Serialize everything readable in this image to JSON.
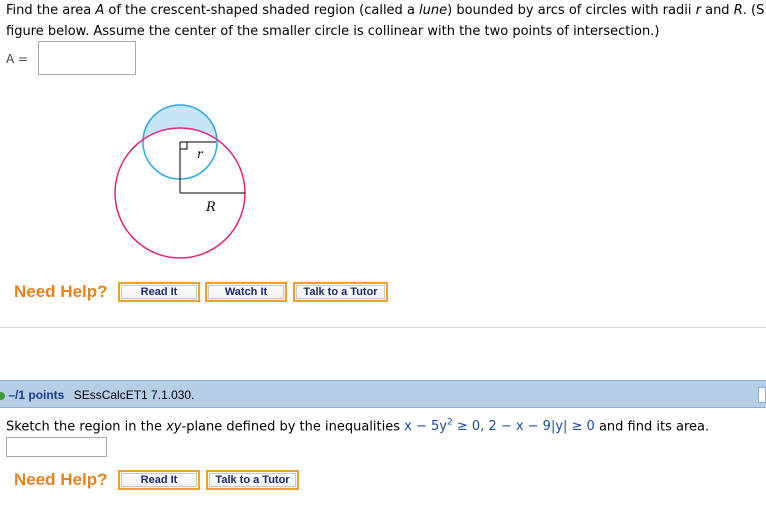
{
  "question1": {
    "line1_a": "Find the area ",
    "line1_var_A": "A",
    "line1_b": " of the crescent-shaped shaded region (called a ",
    "line1_lune": "lune",
    "line1_c": ") bounded by arcs of circles with radii ",
    "line1_var_r": "r",
    "line1_d": " and ",
    "line1_var_R": "R",
    "line1_e": ". (S",
    "line2": "figure below. Assume the center of the smaller circle is collinear with the two points of intersection.)",
    "answer_label": "A =",
    "answer_value": "",
    "figure": {
      "small_radius_label": "r",
      "large_radius_label": "R"
    },
    "need_help": "Need Help?",
    "buttons": [
      "Read It",
      "Watch It",
      "Talk to a Tutor"
    ]
  },
  "question2": {
    "points": "–/1 points",
    "code": "SEssCalcET1 7.1.030.",
    "text_a": "Sketch the region in the ",
    "text_plane": "xy",
    "text_b": "-plane defined by the inequalities ",
    "ineq_1": "x − 5y",
    "ineq_1_exp": "2",
    "ineq_1_rest": " ≥ 0, 2 − x − 9|y| ≥ 0",
    "text_c": "  and find its area.",
    "answer_value": "",
    "need_help": "Need Help?",
    "buttons": [
      "Read It",
      "Talk to a Tutor"
    ]
  },
  "colors": {
    "accent_orange": "#e8821e",
    "points_bar": "#b7cfe6",
    "small_circle": "#29a9e0",
    "large_circle": "#e0257a",
    "lune_fill": "#c5e4f7"
  }
}
